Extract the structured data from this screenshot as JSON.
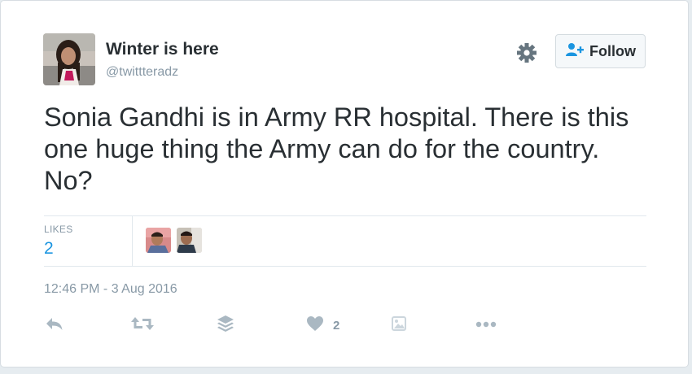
{
  "user": {
    "name": "Winter is here",
    "handle": "@twittteradz",
    "avatar_icon": "profile-photo"
  },
  "header": {
    "settings_icon": "gear-icon",
    "follow_label": "Follow",
    "follow_icon": "follow-user-icon"
  },
  "tweet": {
    "text": "Sonia Gandhi is in Army RR hospital. There is this one huge thing the Army can do for the country. No?"
  },
  "stats": {
    "likes_label": "LIKES",
    "likes_count": "2",
    "liker_avatars": [
      "liker-avatar-1",
      "liker-avatar-2"
    ]
  },
  "timestamp": "12:46 PM - 3 Aug 2016",
  "actions": {
    "reply_icon": "reply-icon",
    "retweet_icon": "retweet-icon",
    "buffer_icon": "buffer-icon",
    "like_icon": "heart-icon",
    "like_count": "2",
    "media_icon": "media-icon",
    "more_icon": "more-icon"
  },
  "colors": {
    "text": "#292f33",
    "muted": "#8899a6",
    "link": "#1b95e0",
    "divider": "#e1e8ed",
    "background": "#e6ecf0"
  }
}
